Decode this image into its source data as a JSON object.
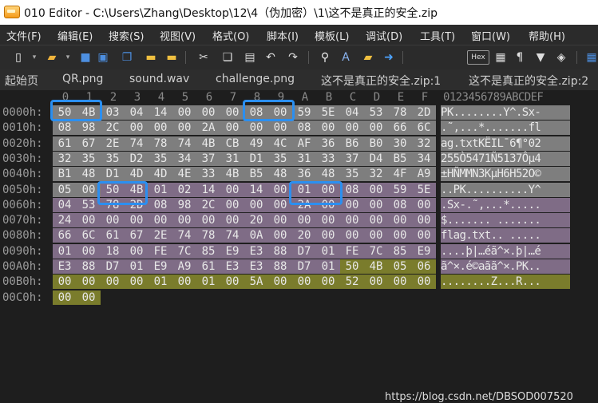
{
  "window": {
    "title": "010 Editor - C:\\Users\\Zhang\\Desktop\\12\\4（伪加密）\\1\\这不是真正的安全.zip"
  },
  "menu": [
    "文件(F)",
    "编辑(E)",
    "搜索(S)",
    "视图(V)",
    "格式(O)",
    "脚本(I)",
    "模板(L)",
    "调试(D)",
    "工具(T)",
    "窗口(W)",
    "帮助(H)"
  ],
  "toolbar": {
    "icons": [
      "new-file",
      "open-folder",
      "save",
      "save-all",
      "copy-file",
      "new-folder",
      "folder",
      "cut",
      "copy",
      "paste",
      "undo",
      "redo",
      "find",
      "replace",
      "find-in-files",
      "goto",
      "hex",
      "calculator",
      "paragraph",
      "bookmark",
      "eraser",
      "grid"
    ],
    "hex_label": "Hex"
  },
  "tabs": [
    "起始页",
    "QR.png",
    "sound.wav",
    "challenge.png",
    "这不是真正的安全.zip:1",
    "这不是真正的安全.zip:2"
  ],
  "columns": [
    "0",
    "1",
    "2",
    "3",
    "4",
    "5",
    "6",
    "7",
    "8",
    "9",
    "A",
    "B",
    "C",
    "D",
    "E",
    "F"
  ],
  "ascii_header": "0123456789ABCDEF",
  "rows": [
    {
      "offset": "0000h:",
      "bytes": [
        "50",
        "4B",
        "03",
        "04",
        "14",
        "00",
        "00",
        "00",
        "08",
        "00",
        "59",
        "5E",
        "04",
        "53",
        "78",
        "2D"
      ],
      "ascii": "PK........Y^.Sx-"
    },
    {
      "offset": "0010h:",
      "bytes": [
        "08",
        "98",
        "2C",
        "00",
        "00",
        "00",
        "2A",
        "00",
        "00",
        "00",
        "08",
        "00",
        "00",
        "00",
        "66",
        "6C"
      ],
      "ascii": ".˜,...*.......fl"
    },
    {
      "offset": "0020h:",
      "bytes": [
        "61",
        "67",
        "2E",
        "74",
        "78",
        "74",
        "4B",
        "CB",
        "49",
        "4C",
        "AF",
        "36",
        "B6",
        "B0",
        "30",
        "32"
      ],
      "ascii": "ag.txtKËIL¯6¶°02"
    },
    {
      "offset": "0030h:",
      "bytes": [
        "32",
        "35",
        "35",
        "D2",
        "35",
        "34",
        "37",
        "31",
        "D1",
        "35",
        "31",
        "33",
        "37",
        "D4",
        "B5",
        "34"
      ],
      "ascii": "255Ò5471Ñ5137Ôµ4"
    },
    {
      "offset": "0040h:",
      "bytes": [
        "B1",
        "48",
        "D1",
        "4D",
        "4D",
        "4E",
        "33",
        "4B",
        "B5",
        "48",
        "36",
        "48",
        "35",
        "32",
        "4F",
        "A9"
      ],
      "ascii": "±HÑMMN3KµH6H52O©"
    },
    {
      "offset": "0050h:",
      "bytes": [
        "05",
        "00",
        "50",
        "4B",
        "01",
        "02",
        "14",
        "00",
        "14",
        "00",
        "01",
        "00",
        "08",
        "00",
        "59",
        "5E"
      ],
      "ascii": "..PK..........Y^"
    },
    {
      "offset": "0060h:",
      "bytes": [
        "04",
        "53",
        "78",
        "2D",
        "08",
        "98",
        "2C",
        "00",
        "00",
        "00",
        "2A",
        "00",
        "00",
        "00",
        "08",
        "00"
      ],
      "ascii": ".Sx-.˜,...*....."
    },
    {
      "offset": "0070h:",
      "bytes": [
        "24",
        "00",
        "00",
        "00",
        "00",
        "00",
        "00",
        "00",
        "20",
        "00",
        "00",
        "00",
        "00",
        "00",
        "00",
        "00"
      ],
      "ascii": "$....... ......."
    },
    {
      "offset": "0080h:",
      "bytes": [
        "66",
        "6C",
        "61",
        "67",
        "2E",
        "74",
        "78",
        "74",
        "0A",
        "00",
        "20",
        "00",
        "00",
        "00",
        "00",
        "00"
      ],
      "ascii": "flag.txt.. ....."
    },
    {
      "offset": "0090h:",
      "bytes": [
        "01",
        "00",
        "18",
        "00",
        "FE",
        "7C",
        "85",
        "E9",
        "E3",
        "88",
        "D7",
        "01",
        "FE",
        "7C",
        "85",
        "E9"
      ],
      "ascii": "....þ|…éã^×.þ|…é"
    },
    {
      "offset": "00A0h:",
      "bytes": [
        "E3",
        "88",
        "D7",
        "01",
        "E9",
        "A9",
        "61",
        "E3",
        "E3",
        "88",
        "D7",
        "01",
        "50",
        "4B",
        "05",
        "06"
      ],
      "ascii": "ã^×.é©aãã^×.PK.."
    },
    {
      "offset": "00B0h:",
      "bytes": [
        "00",
        "00",
        "00",
        "00",
        "01",
        "00",
        "01",
        "00",
        "5A",
        "00",
        "00",
        "00",
        "52",
        "00",
        "00",
        "00"
      ],
      "ascii": "........Z...R..."
    },
    {
      "offset": "00C0h:",
      "bytes": [
        "00",
        "00"
      ],
      "ascii": ""
    }
  ],
  "colors": {
    "local_header": "#7e7e7e",
    "central_dir": "#7f6c86",
    "end_record": "#7a7c2c",
    "highlight": "#2b8ff0"
  },
  "watermark": "https://blog.csdn.net/DBSOD007520"
}
